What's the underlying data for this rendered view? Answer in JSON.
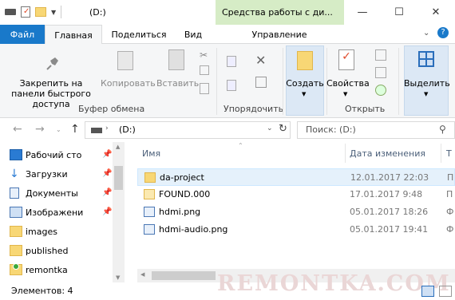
{
  "window": {
    "title": "(D:)",
    "context_tab": "Средства работы с ди...",
    "minimize": "—",
    "maximize": "☐",
    "close": "✕"
  },
  "tabs": {
    "file": "Файл",
    "home": "Главная",
    "share": "Поделиться",
    "view": "Вид",
    "manage": "Управление"
  },
  "ribbon": {
    "pin": "Закрепить на панели быстрого доступа",
    "copy": "Копировать",
    "paste": "Вставить",
    "clipboard_group": "Буфер обмена",
    "organize_group": "Упорядочить",
    "new": "Создать",
    "properties": "Свойства",
    "open_group": "Открыть",
    "select": "Выделить"
  },
  "address": {
    "path": "(D:)",
    "search_placeholder": "Поиск: (D:)"
  },
  "nav": [
    {
      "label": "Рабочий сто",
      "icon": "desktop-icon"
    },
    {
      "label": "Загрузки",
      "icon": "download-icon"
    },
    {
      "label": "Документы",
      "icon": "documents-icon"
    },
    {
      "label": "Изображени",
      "icon": "pictures-icon"
    },
    {
      "label": "images",
      "icon": "folder-icon"
    },
    {
      "label": "published",
      "icon": "folder-icon"
    },
    {
      "label": "remontka",
      "icon": "folder-icon"
    }
  ],
  "columns": {
    "name": "Имя",
    "date": "Дата изменения",
    "type": "Т"
  },
  "files": [
    {
      "name": "da-project",
      "date": "12.01.2017 22:03",
      "type": "П"
    },
    {
      "name": "FOUND.000",
      "date": "17.01.2017 9:48",
      "type": "П"
    },
    {
      "name": "hdmi.png",
      "date": "05.01.2017 18:26",
      "type": "Ф"
    },
    {
      "name": "hdmi-audio.png",
      "date": "05.01.2017 19:41",
      "type": "Ф"
    }
  ],
  "status": "Элементов: 4",
  "watermark": "REMONTKA.COM"
}
